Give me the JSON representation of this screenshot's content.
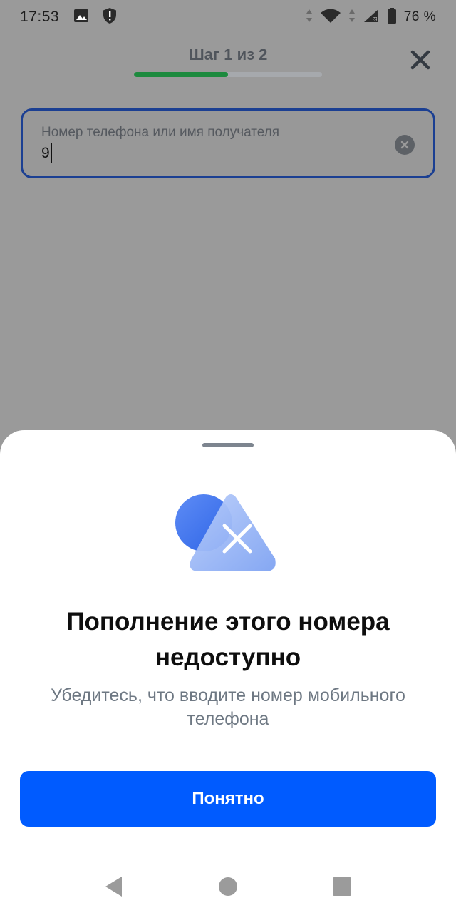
{
  "status_bar": {
    "time": "17:53",
    "battery_text": "76 %",
    "icons": [
      "image-icon",
      "shield-alert-icon",
      "data-arrows-icon",
      "wifi-icon",
      "signal-icon",
      "battery-icon"
    ]
  },
  "header": {
    "step_text": "Шаг 1 из 2",
    "progress_fraction": 0.5,
    "progress_color": "#1d8a3e"
  },
  "recipient_field": {
    "label": "Номер телефона или имя получателя",
    "value": "9",
    "border_color": "#1b3f92"
  },
  "sheet": {
    "title": "Пополнение этого номера недоступно",
    "subtitle": "Убедитесь, что вводите номер мобильного телефона",
    "button_label": "Понятно",
    "button_color": "#005bff"
  },
  "nav_bar": {
    "icons": [
      "back-icon",
      "home-icon",
      "recents-icon"
    ]
  }
}
